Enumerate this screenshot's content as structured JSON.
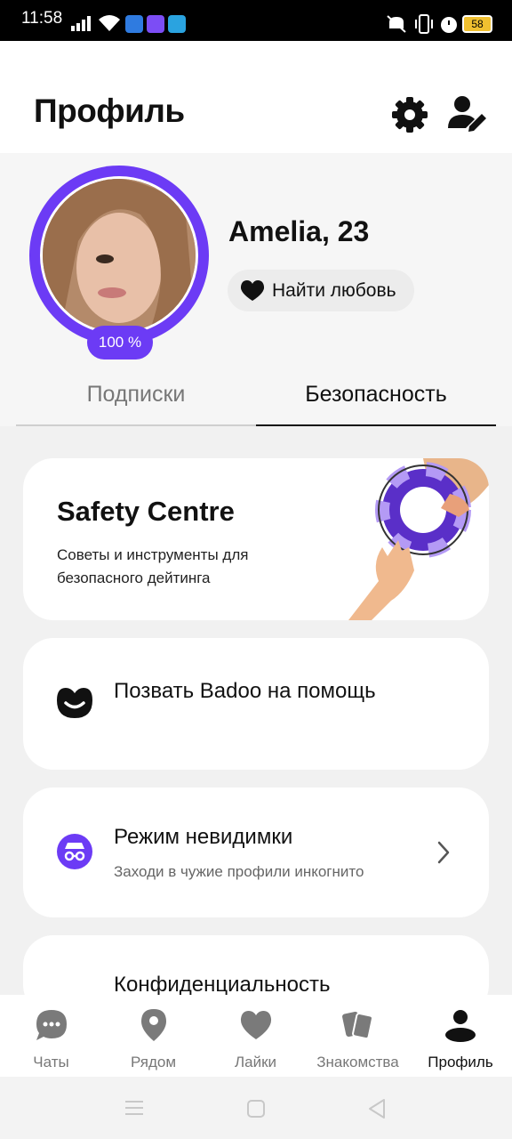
{
  "status_bar": {
    "time": "11:58",
    "battery": "58",
    "icons": [
      "signal-icon",
      "wifi-icon",
      "app-notification-icon",
      "badoo-notification-icon",
      "telegram-icon",
      "mute-icon",
      "vibrate-icon",
      "alarm-icon",
      "battery-icon"
    ]
  },
  "header": {
    "title": "Профиль",
    "settings_icon": "gear-icon",
    "edit_icon": "edit-profile-icon"
  },
  "profile": {
    "name": "Amelia, 23",
    "completion": "100 %",
    "mode_button": "Найти любовь",
    "accent_color": "#6c3bf5"
  },
  "tabs": [
    {
      "label": "Подписки",
      "active": false
    },
    {
      "label": "Безопасность",
      "active": true
    }
  ],
  "cards": {
    "safety": {
      "title": "Safety Centre",
      "description": "Советы и инструменты для безопасного дейтинга"
    },
    "help": {
      "title": "Позвать Badoo на помощь"
    },
    "invisible": {
      "title": "Режим невидимки",
      "subtitle": "Заходи в чужие профили инкогнито"
    },
    "privacy": {
      "title": "Конфиденциальность"
    }
  },
  "bottom_nav": [
    {
      "label": "Чаты",
      "icon": "chat-icon",
      "active": false
    },
    {
      "label": "Рядом",
      "icon": "location-icon",
      "active": false
    },
    {
      "label": "Лайки",
      "icon": "heart-icon",
      "active": false
    },
    {
      "label": "Знакомства",
      "icon": "cards-icon",
      "active": false
    },
    {
      "label": "Профиль",
      "icon": "profile-icon",
      "active": true
    }
  ]
}
